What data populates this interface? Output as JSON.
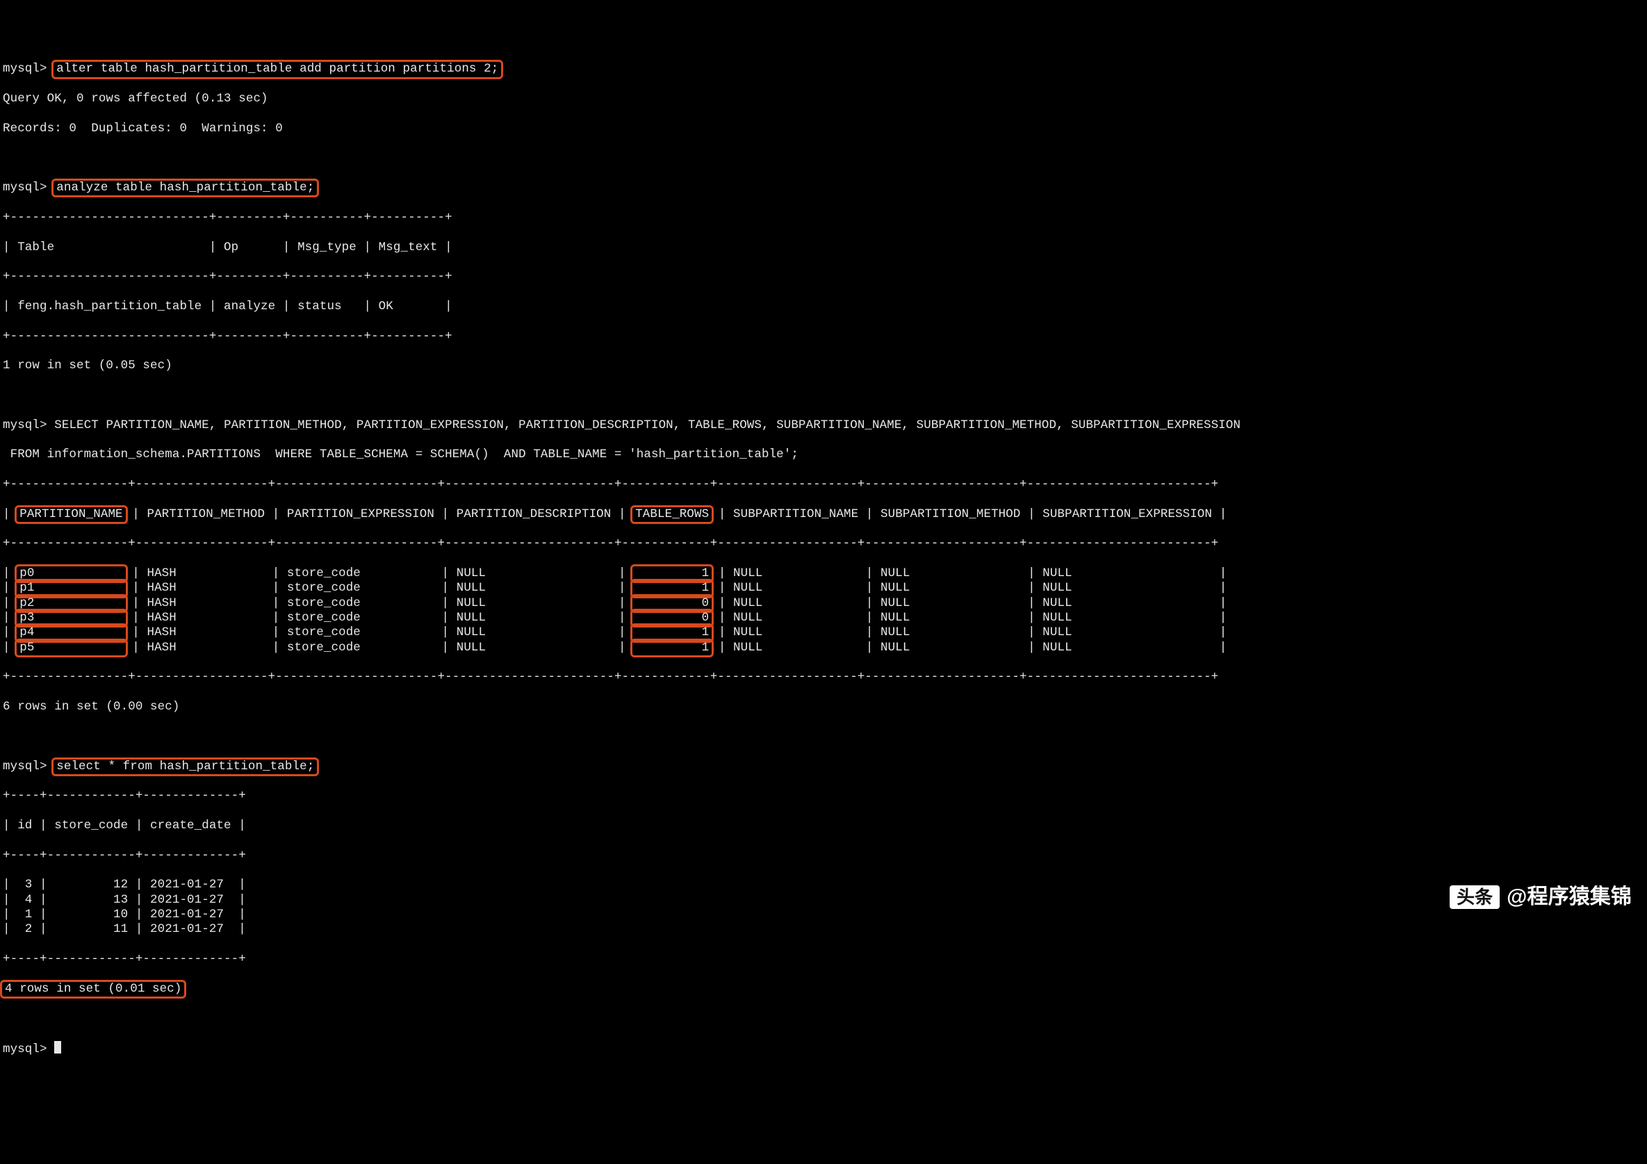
{
  "prompt": "mysql>",
  "cmd1": "alter table hash_partition_table add partition partitions 2;",
  "cmd1_result_l1": "Query OK, 0 rows affected (0.13 sec)",
  "cmd1_result_l2": "Records: 0  Duplicates: 0  Warnings: 0",
  "cmd2": "analyze table hash_partition_table;",
  "tbl_analyze_border": "+---------------------------+---------+----------+----------+",
  "tbl_analyze_header": "| Table                     | Op      | Msg_type | Msg_text |",
  "tbl_analyze_row": "| feng.hash_partition_table | analyze | status   | OK       |",
  "tbl_analyze_footer": "1 row in set (0.05 sec)",
  "cmd3_l1": "SELECT PARTITION_NAME, PARTITION_METHOD, PARTITION_EXPRESSION, PARTITION_DESCRIPTION, TABLE_ROWS, SUBPARTITION_NAME, SUBPARTITION_METHOD, SUBPARTITION_EXPRESSION",
  "cmd3_l2": " FROM information_schema.PARTITIONS  WHERE TABLE_SCHEMA = SCHEMA()  AND TABLE_NAME = 'hash_partition_table';",
  "part_border": "+----------------+------------------+----------------------+-----------------------+------------+-------------------+---------------------+-------------------------+",
  "part_hdr_a": "| ",
  "part_hdr_name": "PARTITION_NAME",
  "part_hdr_b": " | PARTITION_METHOD | PARTITION_EXPRESSION | PARTITION_DESCRIPTION | ",
  "part_hdr_rows": "TABLE_ROWS",
  "part_hdr_c": " | SUBPARTITION_NAME | SUBPARTITION_METHOD | SUBPARTITION_EXPRESSION |",
  "part_rows": [
    {
      "a": "| ",
      "name": "p0            ",
      "b": " | HASH             | store_code           | NULL                  | ",
      "rows": "         1",
      "c": " | NULL              | NULL                | NULL                    |"
    },
    {
      "a": "| ",
      "name": "p1            ",
      "b": " | HASH             | store_code           | NULL                  | ",
      "rows": "         1",
      "c": " | NULL              | NULL                | NULL                    |"
    },
    {
      "a": "| ",
      "name": "p2            ",
      "b": " | HASH             | store_code           | NULL                  | ",
      "rows": "         0",
      "c": " | NULL              | NULL                | NULL                    |"
    },
    {
      "a": "| ",
      "name": "p3            ",
      "b": " | HASH             | store_code           | NULL                  | ",
      "rows": "         0",
      "c": " | NULL              | NULL                | NULL                    |"
    },
    {
      "a": "| ",
      "name": "p4            ",
      "b": " | HASH             | store_code           | NULL                  | ",
      "rows": "         1",
      "c": " | NULL              | NULL                | NULL                    |"
    },
    {
      "a": "| ",
      "name": "p5            ",
      "b": " | HASH             | store_code           | NULL                  | ",
      "rows": "         1",
      "c": " | NULL              | NULL                | NULL                    |"
    }
  ],
  "part_footer": "6 rows in set (0.00 sec)",
  "cmd4": "select * from hash_partition_table;",
  "sel_border": "+----+------------+-------------+",
  "sel_header": "| id | store_code | create_date |",
  "sel_rows": [
    "|  3 |         12 | 2021-01-27  |",
    "|  4 |         13 | 2021-01-27  |",
    "|  1 |         10 | 2021-01-27  |",
    "|  2 |         11 | 2021-01-27  |"
  ],
  "sel_footer": "4 rows in set (0.01 sec)",
  "watermark_logo": "头条",
  "watermark_text": "@程序猿集锦"
}
